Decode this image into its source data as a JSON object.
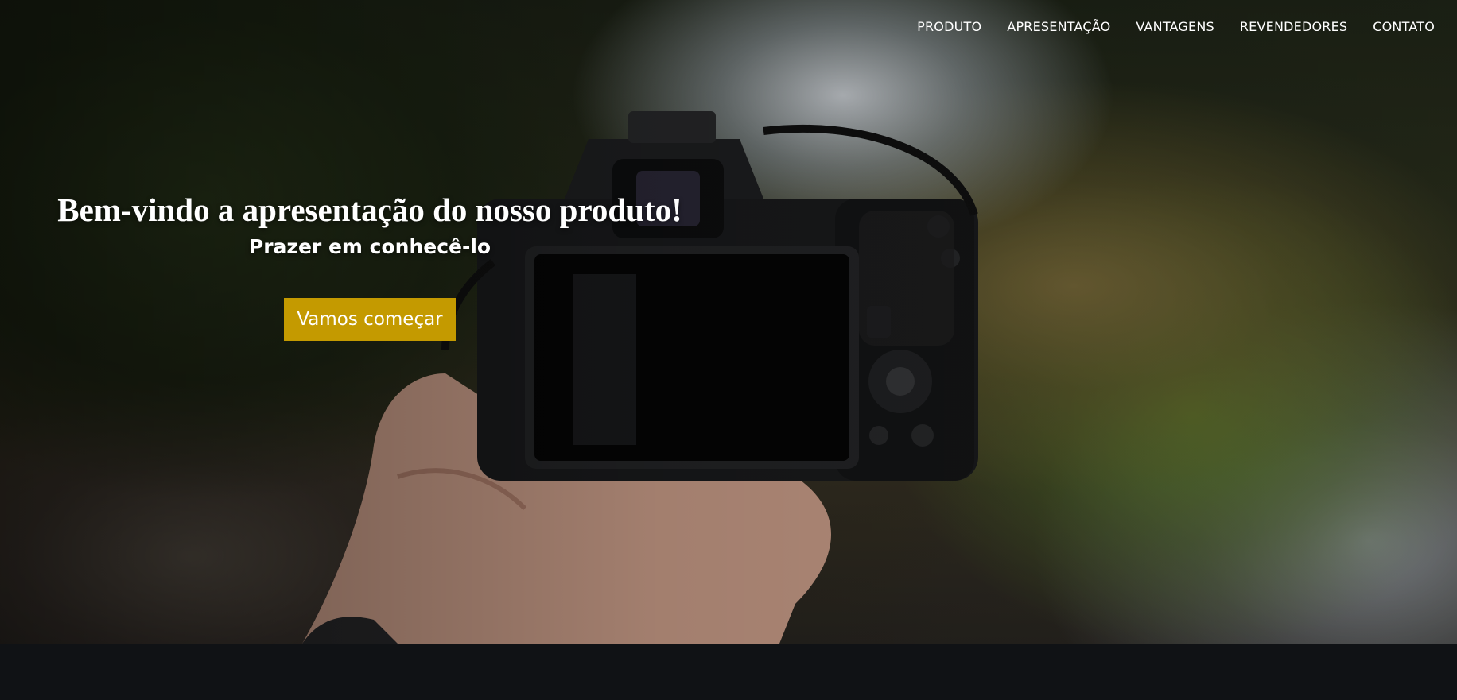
{
  "nav": {
    "items": [
      {
        "label": "PRODUTO"
      },
      {
        "label": "APRESENTAÇÃO"
      },
      {
        "label": "VANTAGENS"
      },
      {
        "label": "REVENDEDORES"
      },
      {
        "label": "CONTATO"
      }
    ]
  },
  "hero": {
    "title": "Bem-vindo a apresentação do nosso produto!",
    "subtitle": "Prazer em conhecê-lo",
    "cta_label": "Vamos começar",
    "accent_color": "#c49a00",
    "background_image": "camera-in-hand-photo"
  },
  "footer": {
    "background_color": "#101215"
  }
}
